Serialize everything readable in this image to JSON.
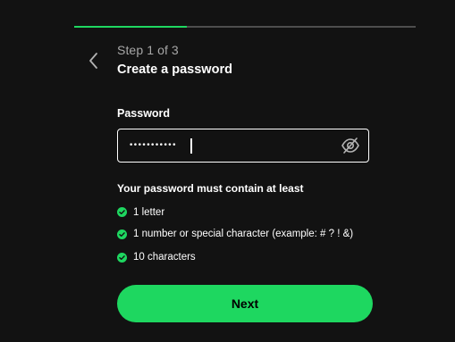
{
  "progress": {
    "current_step": 1,
    "total_steps": 3,
    "fraction_complete": 0.33,
    "track_color": "#4d4d4d",
    "fill_color": "#1ed760"
  },
  "header": {
    "back_icon": "chevron-left-icon",
    "step_label": "Step 1 of 3",
    "title": "Create a password"
  },
  "password_field": {
    "label": "Password",
    "masked_value": "•••••••••••",
    "visibility_icon": "eye-off-icon"
  },
  "requirements": {
    "heading": "Your password must contain at least",
    "items": [
      {
        "text": "1 letter",
        "met": true
      },
      {
        "text": "1 number or special character (example: # ? ! &)",
        "met": true
      },
      {
        "text": "10 characters",
        "met": true
      }
    ],
    "met_color": "#1ed760"
  },
  "actions": {
    "next_label": "Next",
    "accent": "#1ed760"
  }
}
